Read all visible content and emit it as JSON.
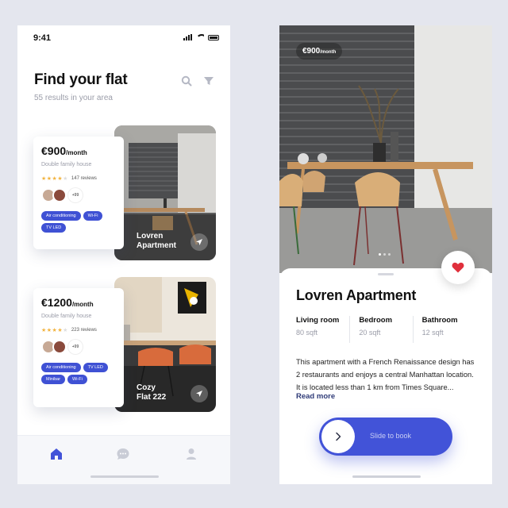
{
  "status": {
    "time": "9:41"
  },
  "list_screen": {
    "title": "Find your flat",
    "subtitle": "55 results in your area",
    "listings": [
      {
        "price": "€900",
        "price_unit": "/month",
        "type": "Double family house",
        "rating": 4,
        "reviews": "147 reviews",
        "more_avatars": "+99",
        "tags": [
          "Air conditioning",
          "Wi-Fi",
          "TV LED"
        ],
        "name_line1": "Lovren",
        "name_line2": "Apartment"
      },
      {
        "price": "€1200",
        "price_unit": "/month",
        "type": "Double family house",
        "rating": 4,
        "reviews": "223 reviews",
        "more_avatars": "+99",
        "tags": [
          "Air conditioning",
          "TV LED",
          "Minibar",
          "Wi-Fi"
        ],
        "name_line1": "Cozy",
        "name_line2": "Flat 222"
      }
    ],
    "tabs": [
      "home-icon",
      "chat-icon",
      "profile-icon"
    ]
  },
  "detail_screen": {
    "price": "€900",
    "price_unit": "/month",
    "title": "Lovren Apartment",
    "specs": [
      {
        "label": "Living room",
        "value": "80 sqft"
      },
      {
        "label": "Bedroom",
        "value": "20 sqft"
      },
      {
        "label": "Bathroom",
        "value": "12 sqft"
      }
    ],
    "description": "This apartment with a French Renaissance design has 2 restaurants and enjoys a central Manhattan location. It is located less than 1 km from Times Square...",
    "read_more": "Read more",
    "slide_label": "Slide to book"
  },
  "colors": {
    "accent": "#4253d8",
    "tag": "#3f51d4",
    "heart": "#e0303c",
    "star": "#f2b440",
    "background": "#e4e6ee"
  }
}
